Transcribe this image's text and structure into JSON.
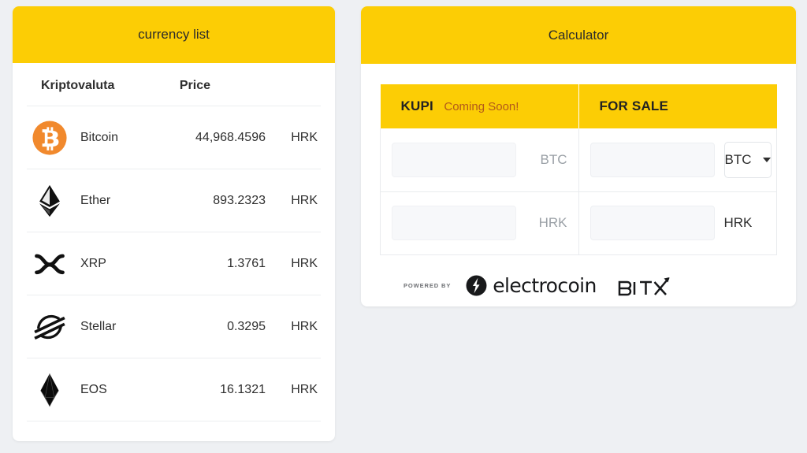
{
  "background_color": "#eef0f3",
  "accent_yellow": "#fccd05",
  "currency_card": {
    "title": "currency list",
    "columns": {
      "crypto": "Kriptovaluta",
      "price": "Price"
    },
    "rows": [
      {
        "icon": "bitcoin-icon",
        "name": "Bitcoin",
        "price": "44,968.4596",
        "unit": "HRK"
      },
      {
        "icon": "ethereum-icon",
        "name": "Ether",
        "price": "893.2323",
        "unit": "HRK"
      },
      {
        "icon": "xrp-icon",
        "name": "XRP",
        "price": "1.3761",
        "unit": "HRK"
      },
      {
        "icon": "stellar-icon",
        "name": "Stellar",
        "price": "0.3295",
        "unit": "HRK"
      },
      {
        "icon": "eos-icon",
        "name": "EOS",
        "price": "16.1321",
        "unit": "HRK"
      }
    ]
  },
  "calculator_card": {
    "title": "Calculator",
    "buy_column": {
      "label": "KUPI",
      "badge": "Coming Soon!",
      "badge_color": "#b2591a",
      "amount_crypto_value": "",
      "amount_crypto_placeholder": "",
      "unit_crypto": "BTC",
      "amount_fiat_value": "",
      "amount_fiat_placeholder": "",
      "unit_fiat": "HRK"
    },
    "sell_column": {
      "label": "FOR SALE",
      "amount_crypto_value": "",
      "amount_crypto_placeholder": "",
      "selected_currency": "BTC",
      "currency_options": [
        "BTC"
      ],
      "amount_fiat_value": "",
      "amount_fiat_placeholder": "",
      "unit_fiat": "HRK"
    },
    "footer": {
      "powered_by": "POWERED BY",
      "electrocoin": "electrocoin",
      "bitx": "BITX"
    }
  }
}
